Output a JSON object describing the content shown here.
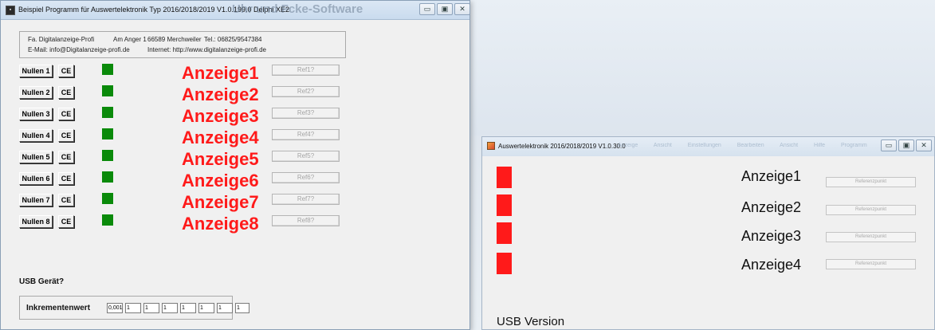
{
  "window1": {
    "title": "Beispiel Programm für Auswertelektronik Typ 2016/2018/2019 V1.0.199.0 Delphi XE2",
    "ghost_title": "Uhr und Fcke-Software",
    "company": {
      "name": "Fa. Digitalanzeige-Profi",
      "street": "Am Anger 1",
      "city": "66589 Merchweiler",
      "phone": "Tel.: 06825/9547384",
      "email": "E-Mail: info@Digitalanzeige-profi.de",
      "web": "Internet: http://www.digitalanzeige-profi.de"
    },
    "rows": [
      {
        "nullen": "Nullen 1",
        "ce": "CE",
        "anzeige": "Anzeige1",
        "ref": "Ref1?"
      },
      {
        "nullen": "Nullen 2",
        "ce": "CE",
        "anzeige": "Anzeige2",
        "ref": "Ref2?"
      },
      {
        "nullen": "Nullen 3",
        "ce": "CE",
        "anzeige": "Anzeige3",
        "ref": "Ref3?"
      },
      {
        "nullen": "Nullen 4",
        "ce": "CE",
        "anzeige": "Anzeige4",
        "ref": "Ref4?"
      },
      {
        "nullen": "Nullen 5",
        "ce": "CE",
        "anzeige": "Anzeige5",
        "ref": "Ref5?"
      },
      {
        "nullen": "Nullen 6",
        "ce": "CE",
        "anzeige": "Anzeige6",
        "ref": "Ref6?"
      },
      {
        "nullen": "Nullen 7",
        "ce": "CE",
        "anzeige": "Anzeige7",
        "ref": "Ref7?"
      },
      {
        "nullen": "Nullen 8",
        "ce": "CE",
        "anzeige": "Anzeige8",
        "ref": "Ref8?"
      }
    ],
    "usb_label": "USB Gerät?",
    "inkrement": {
      "label": "Inkrementenwert",
      "values": [
        "0,001",
        "1",
        "1",
        "1",
        "1",
        "1",
        "1",
        "1"
      ]
    },
    "colors": {
      "led": "#0a8a0a",
      "anzeige": "#ff1a1a"
    }
  },
  "window2": {
    "title": "Auswertelektronik 2016/2018/2019 V1.0.30.0",
    "ghost_titles": "Anzeige Ansicht Einstellungen Bearbeiten Ansicht Hilfe Programm",
    "rows": [
      {
        "anzeige": "Anzeige1",
        "ref": "Referenzpunkt"
      },
      {
        "anzeige": "Anzeige2",
        "ref": "Referenzpunkt"
      },
      {
        "anzeige": "Anzeige3",
        "ref": "Referenzpunkt"
      },
      {
        "anzeige": "Anzeige4",
        "ref": "Referenzpunkt"
      }
    ],
    "usb_label": "USB Version",
    "colors": {
      "led": "#ff1a1a"
    }
  },
  "caption_buttons": {
    "minimize": "▭",
    "maximize": "▣",
    "close": "✕"
  }
}
